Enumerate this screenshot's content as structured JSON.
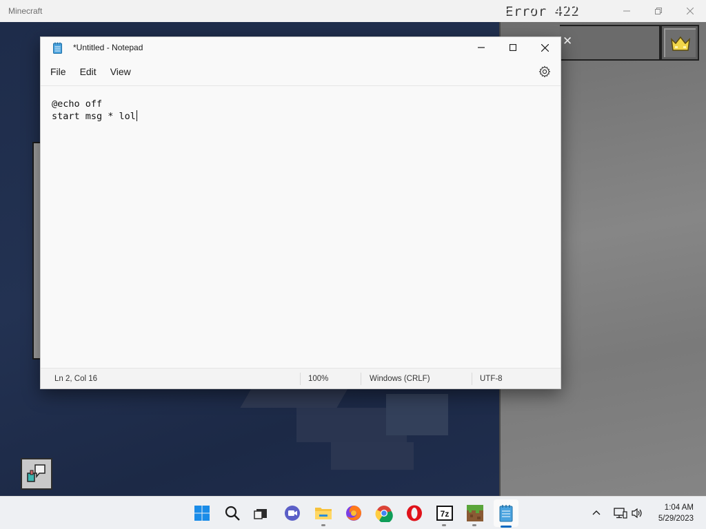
{
  "minecraft": {
    "window_title": "Minecraft",
    "error_text": "Error 422",
    "close_x": "✕"
  },
  "notepad": {
    "title": "*Untitled - Notepad",
    "menu": [
      "File",
      "Edit",
      "View"
    ],
    "lines": [
      "@echo off",
      "start msg * lol"
    ],
    "status": {
      "position": "Ln 2, Col 16",
      "zoom": "100%",
      "line_endings": "Windows (CRLF)",
      "encoding": "UTF-8"
    }
  },
  "taskbar": {
    "pinned": [
      "start-icon",
      "search-icon",
      "task-view-icon",
      "meet-icon",
      "file-explorer-icon",
      "firefox-icon",
      "chrome-icon",
      "opera-icon",
      "7zip-icon",
      "minecraft-icon",
      "notepad-icon"
    ],
    "sevenzip_label": "7z",
    "time": "1:04 AM",
    "date": "5/29/2023"
  },
  "colors": {
    "accent": "#0067c0",
    "game_bg": "#1e2c4a",
    "panel_gray": "#7a7a7a"
  }
}
